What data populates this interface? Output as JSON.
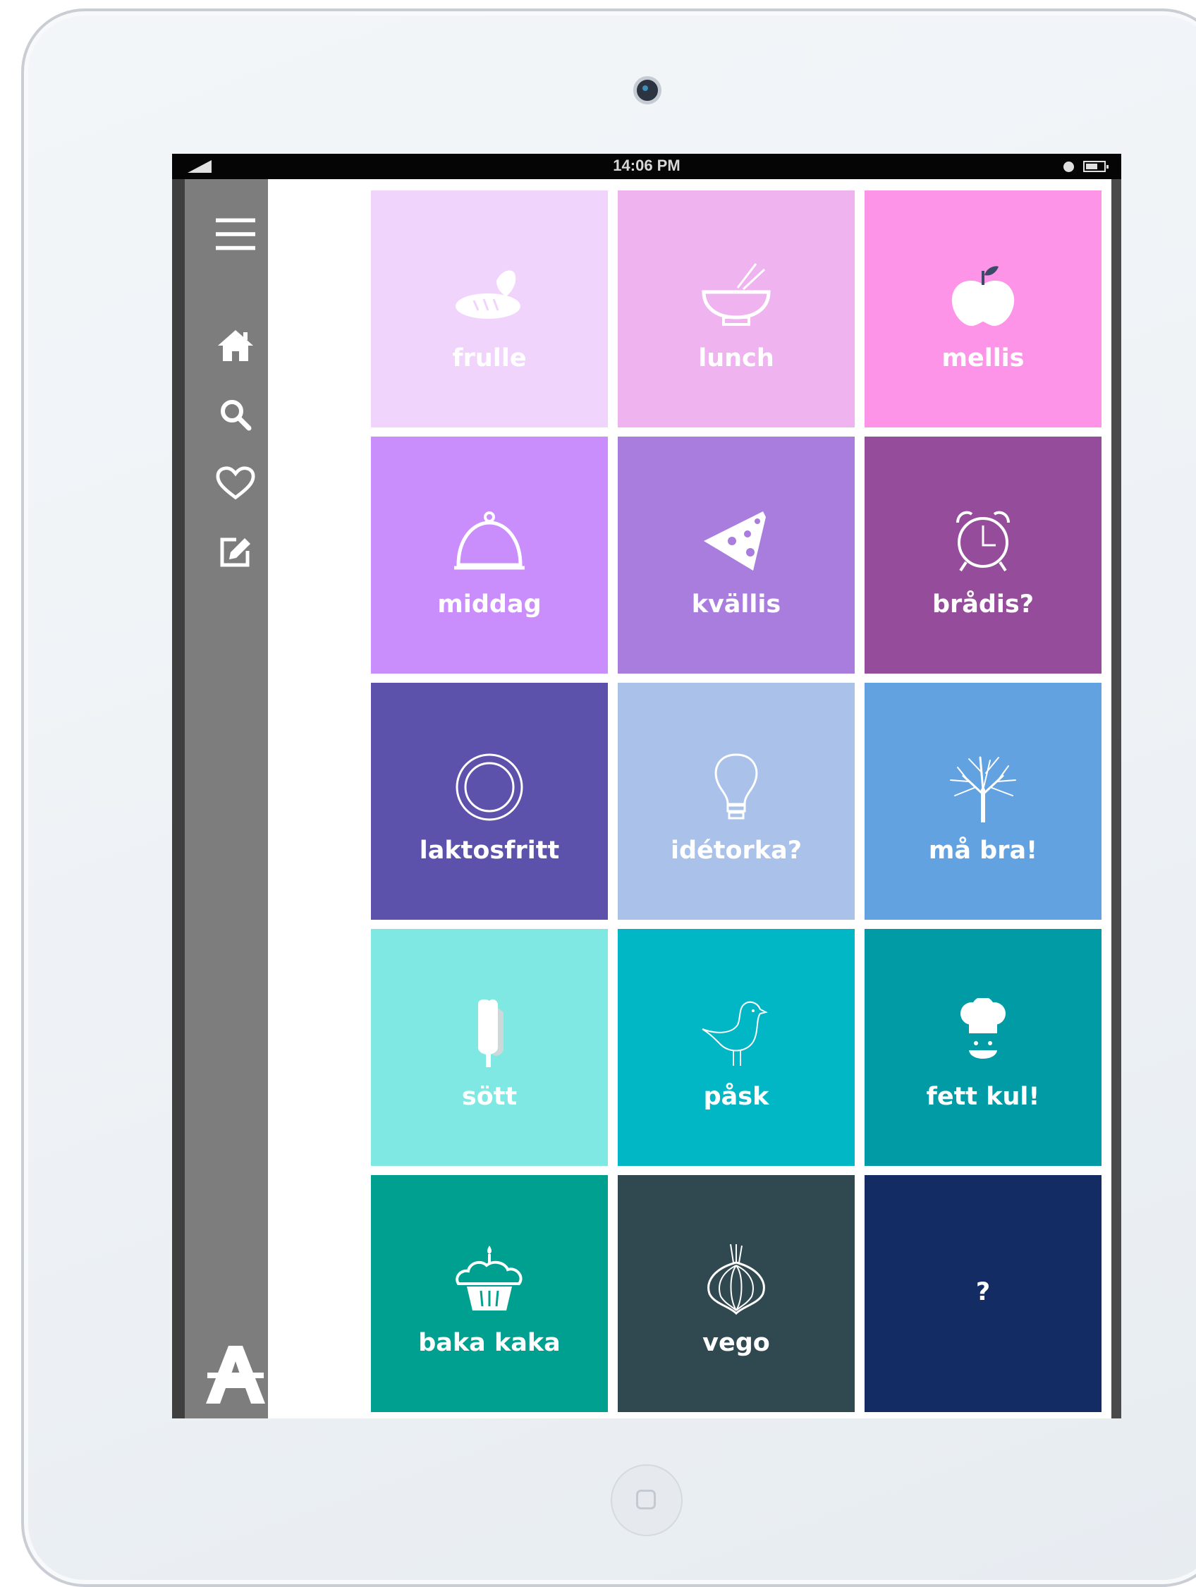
{
  "status_bar": {
    "time": "14:06 PM"
  },
  "sidebar": {
    "items": [
      "menu-icon",
      "home-icon",
      "search-icon",
      "heart-icon",
      "edit-icon"
    ],
    "logo": "A"
  },
  "tiles": [
    {
      "label": "frulle",
      "color": "#f1d4fb",
      "label_color": "#ffffff",
      "icon": "bread-icon"
    },
    {
      "label": "lunch",
      "color": "#efb3f0",
      "icon": "bowl-icon"
    },
    {
      "label": "mellis",
      "color": "#fd94e8",
      "icon": "apple-icon"
    },
    {
      "label": "middag",
      "color": "#c98efb",
      "icon": "cloche-icon"
    },
    {
      "label": "kvällis",
      "color": "#a97ddd",
      "icon": "cheese-icon"
    },
    {
      "label": "brådis?",
      "color": "#944c9b",
      "icon": "alarm-clock-icon"
    },
    {
      "label": "laktosfritt",
      "color": "#5c52ab",
      "icon": "plate-icon"
    },
    {
      "label": "idétorka?",
      "color": "#aac1ea",
      "icon": "lightbulb-icon"
    },
    {
      "label": "må bra!",
      "color": "#62a2e0",
      "icon": "tree-icon"
    },
    {
      "label": "sött",
      "color": "#7fe8e3",
      "icon": "ice-cream-icon"
    },
    {
      "label": "påsk",
      "color": "#01b6c5",
      "icon": "bird-icon"
    },
    {
      "label": "fett kul!",
      "color": "#019ba5",
      "icon": "chef-hat-icon"
    },
    {
      "label": "baka kaka",
      "color": "#00a091",
      "icon": "cupcake-icon"
    },
    {
      "label": "vego",
      "color": "#304850",
      "icon": "onion-icon"
    },
    {
      "label": "?",
      "color": "#132d64",
      "icon": ""
    }
  ]
}
